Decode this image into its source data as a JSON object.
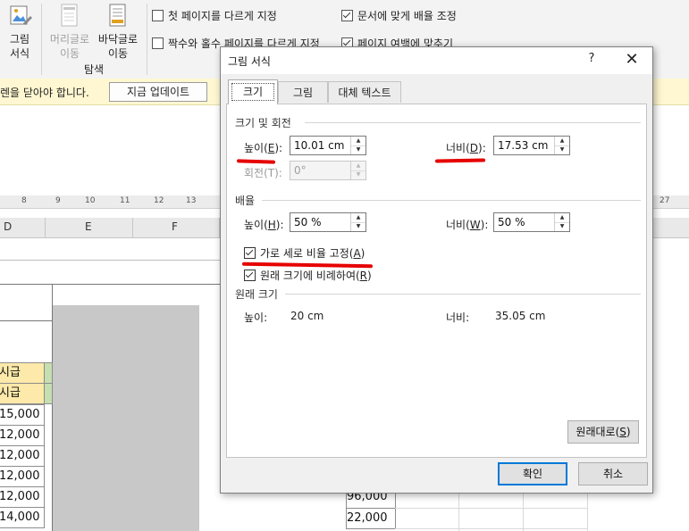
{
  "ribbon": {
    "picture_format_label": "그림\n서식",
    "picture_format_l1": "그림",
    "picture_format_l2": "서식",
    "go_header_l1": "머리글로",
    "go_header_l2": "이동",
    "go_footer_l1": "바닥글로",
    "go_footer_l2": "이동",
    "nav_group_label": "탐색",
    "options": [
      {
        "label": "첫 페이지를 다르게 지정",
        "checked": false
      },
      {
        "label": "문서에 맞게 배율 조정",
        "checked": true
      },
      {
        "label": "짝수와 홀수 페이지를 다르게 지정",
        "checked": false
      },
      {
        "label": "페이지 여백에 맞추기",
        "checked": true
      }
    ]
  },
  "message_bar": {
    "text": "렌을 닫아야 합니다.",
    "button": "지금 업데이트"
  },
  "ruler_ticks": [
    "8",
    "9",
    "10",
    "11",
    "12",
    "13",
    "27"
  ],
  "columns": [
    "D",
    "E",
    "F"
  ],
  "sheet": {
    "header_cells": [
      "시급",
      "시급"
    ],
    "values": [
      "15,000",
      "12,000",
      "12,000",
      "12,000",
      "12,000",
      "14,000"
    ],
    "right_values": [
      "96,000",
      "22,000"
    ]
  },
  "dialog": {
    "title": "그림 서식",
    "help": "?",
    "close": "✕",
    "tabs": [
      {
        "label": "크기",
        "active": true
      },
      {
        "label": "그림",
        "active": false
      },
      {
        "label": "대체 텍스트",
        "active": false
      }
    ],
    "size_group": {
      "title": "크기 및 회전",
      "height_label": "높이(",
      "height_key": "E",
      "height_suffix": "):",
      "height_value": "10.01 cm",
      "width_label": "너비(",
      "width_key": "D",
      "width_suffix": "):",
      "width_value": "17.53 cm",
      "rotation_label": "회전(T):",
      "rotation_value": "0°"
    },
    "scale_group": {
      "title": "배율",
      "height_label": "높이(",
      "height_key": "H",
      "height_suffix": "):",
      "height_value": "50 %",
      "width_label": "너비(",
      "width_key": "W",
      "width_suffix": "):",
      "width_value": "50 %",
      "lock_aspect_label": "가로 세로 비율 고정(",
      "lock_aspect_key": "A",
      "lock_aspect_suffix": ")",
      "lock_aspect_checked": true,
      "relative_label": "원래 크기에 비례하여(",
      "relative_key": "R",
      "relative_suffix": ")",
      "relative_checked": true
    },
    "original_group": {
      "title": "원래 크기",
      "height_label": "높이:",
      "height_value": "20 cm",
      "width_label": "너비:",
      "width_value": "35.05 cm"
    },
    "reset_label": "원래대로(",
    "reset_key": "S",
    "reset_suffix": ")",
    "ok": "확인",
    "cancel": "취소"
  },
  "colors": {
    "annotation_red": "#e60000",
    "message_bar_bg": "#fff7d1",
    "header_cell_fill": "#fde9a9",
    "image_placeholder": "#c8c8c8",
    "primary_border": "#0078d7"
  }
}
